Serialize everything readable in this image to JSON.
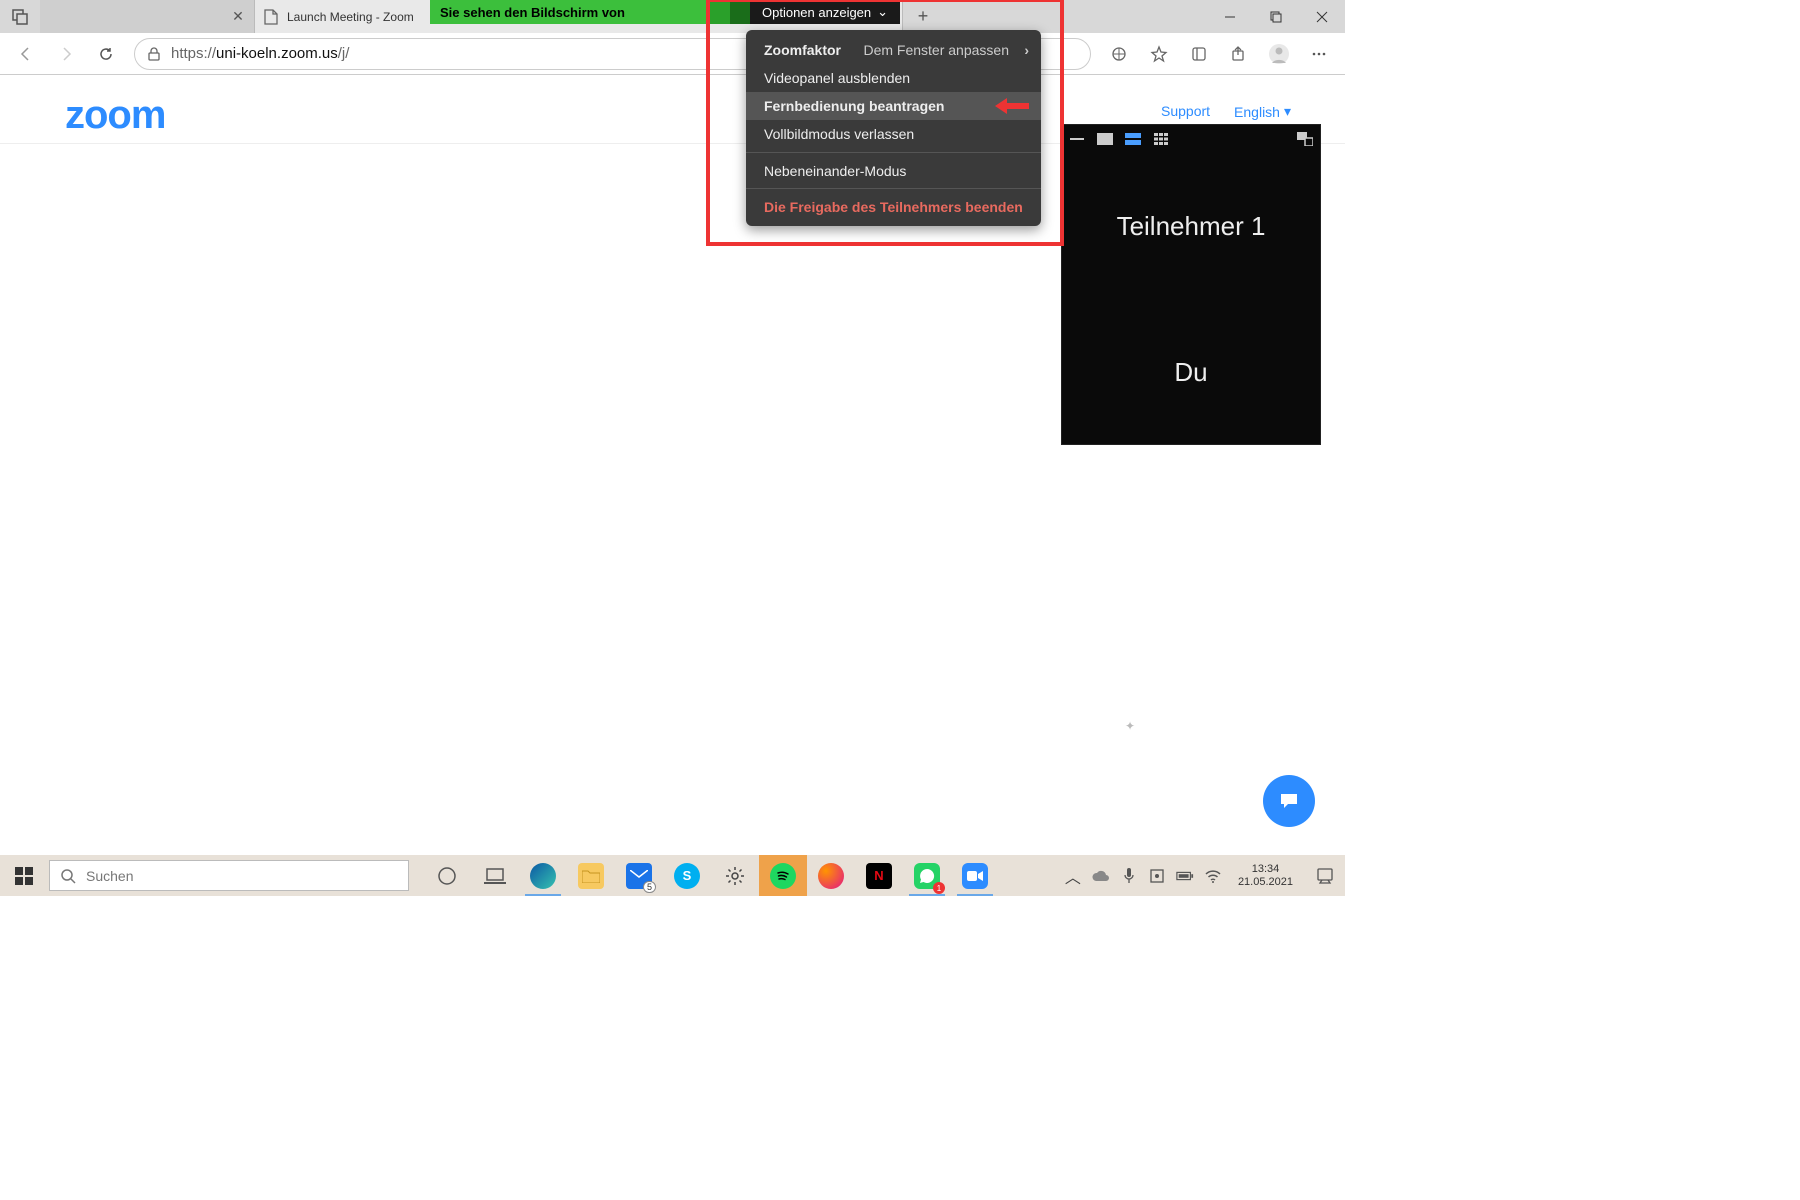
{
  "browser": {
    "tab_second_title": "Launch Meeting - Zoom",
    "url_prefix": "https://",
    "url_domain": "uni-koeln.zoom.us",
    "url_path": "/j/",
    "nav_links": {
      "support": "Support",
      "language": "English"
    }
  },
  "zoom_logo": "zoom",
  "share_bar": {
    "message": "Sie sehen den Bildschirm von",
    "options_label": "Optionen anzeigen"
  },
  "options_menu": {
    "zoom_label": "Zoomfaktor",
    "zoom_value": "Dem Fenster anpassen",
    "items": [
      "Videopanel ausblenden",
      "Fernbedienung beantragen",
      "Vollbildmodus verlassen",
      "Nebeneinander-Modus"
    ],
    "stop": "Die Freigabe des Teilnehmers beenden"
  },
  "participant_panel": {
    "top": "Teilnehmer 1",
    "bottom": "Du"
  },
  "taskbar": {
    "search_placeholder": "Suchen",
    "mail_badge": "5",
    "whatsapp_badge": "1",
    "time": "13:34",
    "date": "21.05.2021"
  }
}
